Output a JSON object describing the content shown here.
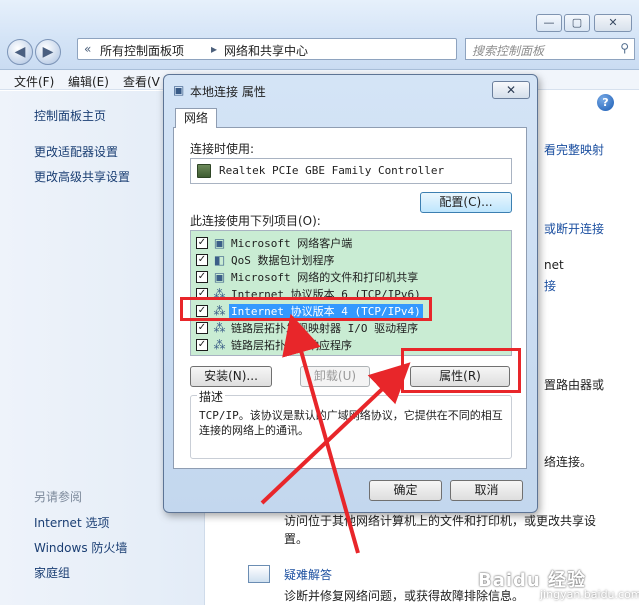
{
  "background_window": {
    "breadcrumb": [
      "所有控制面板项",
      "网络和共享中心"
    ],
    "search_placeholder": "搜索控制面板",
    "menu": [
      "文件(F)",
      "编辑(E)",
      "查看(V"
    ],
    "left_pane": {
      "links": [
        "控制面板主页",
        "更改适配器设置",
        "更改高级共享设置"
      ],
      "see_also_title": "另请参阅",
      "see_also_links": [
        "Internet 选项",
        "Windows 防火墙",
        "家庭组"
      ]
    },
    "right_fragments": {
      "full_map": "看完整映射",
      "connect_disconnect": "或断开连接",
      "net_frag": "net",
      "link_frag": "接",
      "router_frag": "置路由器或",
      "connect_frag": "络连接。",
      "share_desc": "访问位于其他网络计算机上的文件和打印机，或更改共享设",
      "share_desc2": "置。",
      "troubleshoot": "疑难解答",
      "troubleshoot_desc": "诊断并修复网络问题，或获得故障排除信息。"
    }
  },
  "dialog": {
    "title": "本地连接 属性",
    "close_label": "✕",
    "tab_label": "网络",
    "connect_using_label": "连接时使用:",
    "adapter_name": "Realtek PCIe GBE Family Controller",
    "configure_label": "配置(C)...",
    "items_label": "此连接使用下列项目(O):",
    "items": [
      {
        "text": "Microsoft 网络客户端",
        "icon": "network-client-icon",
        "checked": true
      },
      {
        "text": "QoS 数据包计划程序",
        "icon": "qos-icon",
        "checked": true
      },
      {
        "text": "Microsoft 网络的文件和打印机共享",
        "icon": "file-share-icon",
        "checked": true
      },
      {
        "text": "Internet 协议版本 6 (TCP/IPv6)",
        "icon": "protocol-icon",
        "checked": true
      },
      {
        "text": "Internet 协议版本 4 (TCP/IPv4)",
        "icon": "protocol-icon",
        "checked": true,
        "selected": true
      },
      {
        "text": "链路层拓扑发现映射器 I/O 驱动程序",
        "icon": "protocol-icon",
        "checked": true
      },
      {
        "text": "链路层拓扑发现响应程序",
        "icon": "protocol-icon",
        "checked": true
      }
    ],
    "install_label": "安装(N)...",
    "uninstall_label": "卸载(U)",
    "properties_label": "属性(R)",
    "description_title": "描述",
    "description_text": "TCP/IP。该协议是默认的广域网络协议，它提供在不同的相互连接的网络上的通讯。",
    "ok_label": "确定",
    "cancel_label": "取消"
  },
  "watermark": {
    "brand": "Baidu 经验",
    "sub": "jingyan.baidu.com"
  },
  "colors": {
    "annotation_red": "#e8262a",
    "selection_blue": "#3399ff",
    "list_background": "#c9ecd3"
  }
}
